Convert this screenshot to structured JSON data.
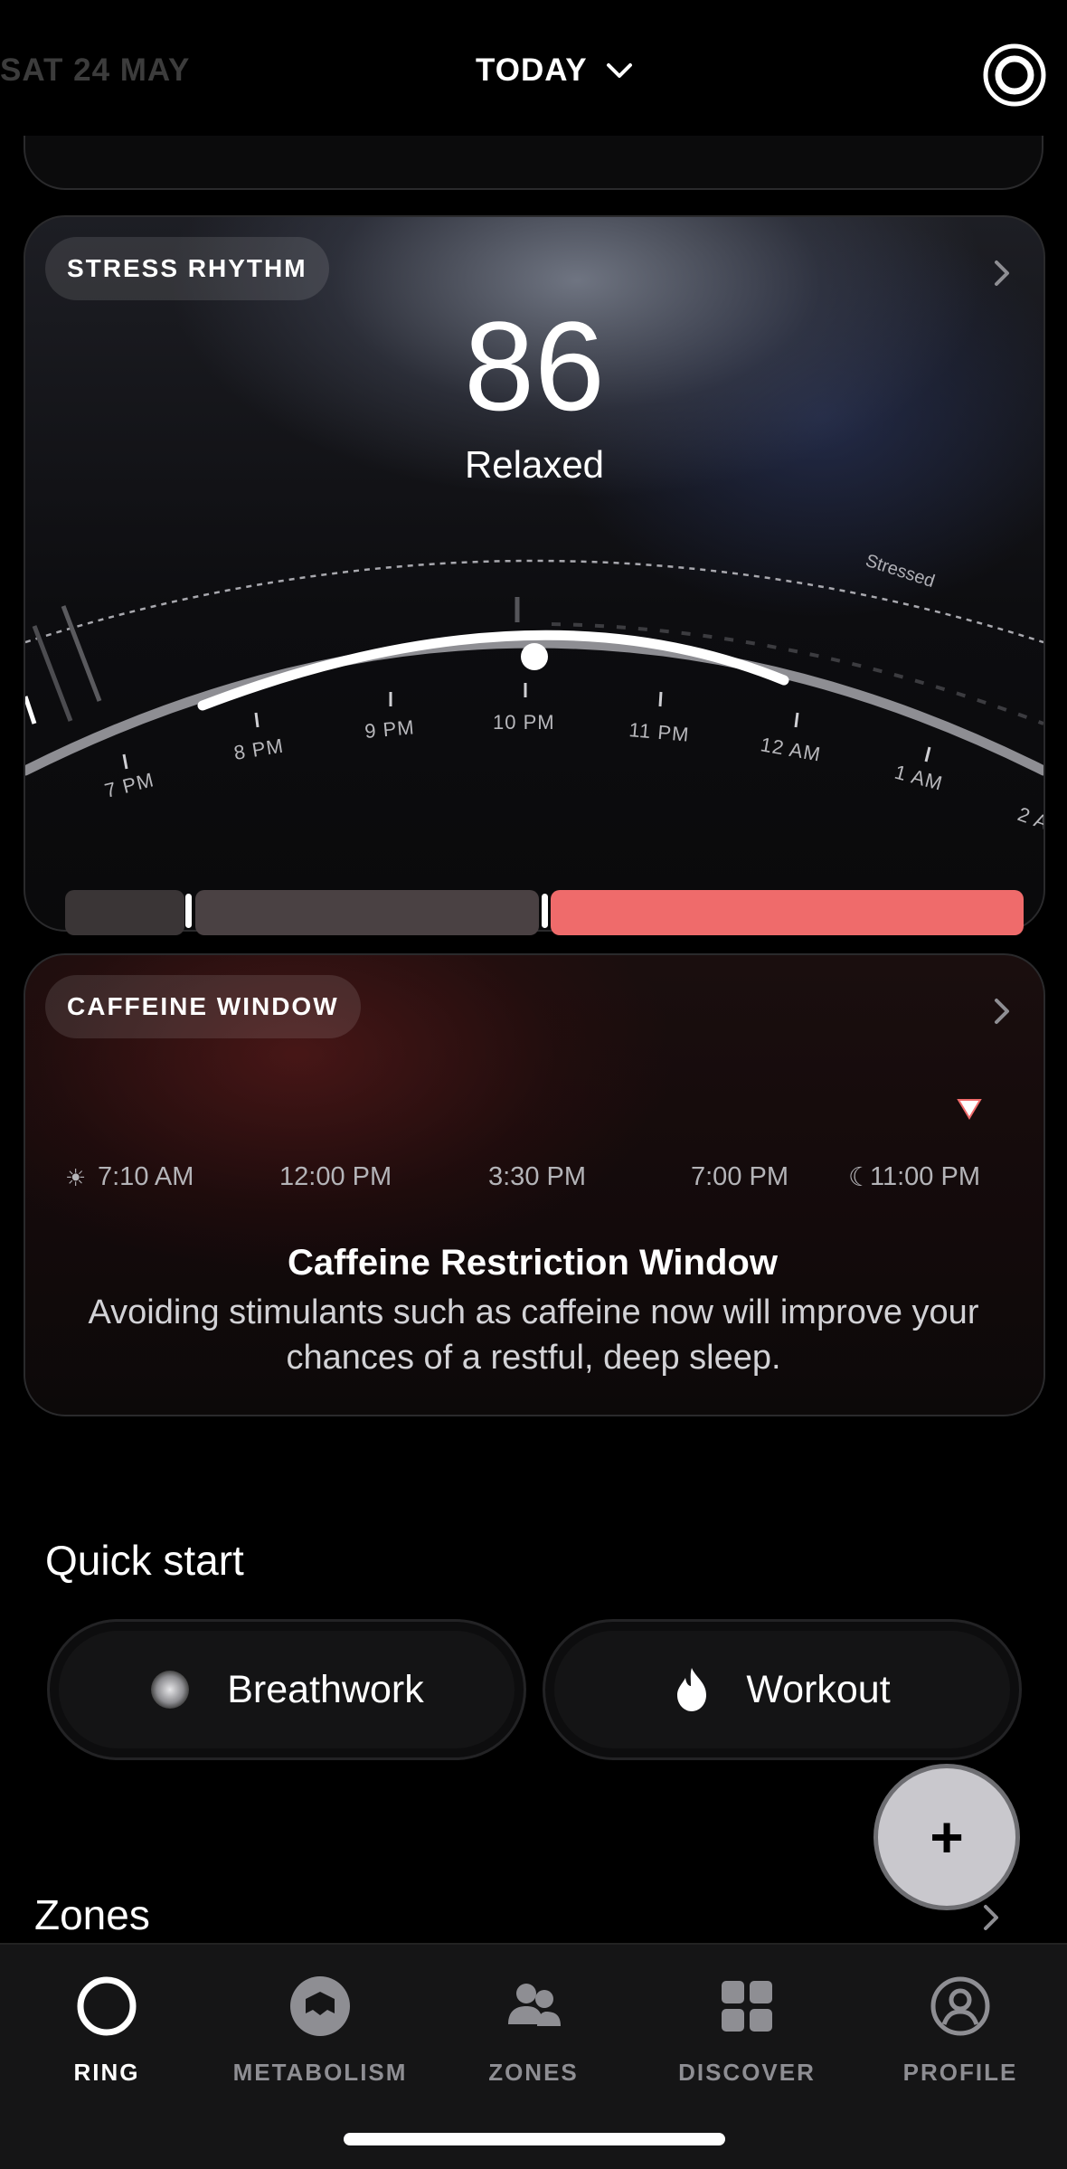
{
  "header": {
    "date": "SAT 24 MAY",
    "today_label": "TODAY"
  },
  "stress": {
    "title": "STRESS RHYTHM",
    "score": "86",
    "state": "Relaxed",
    "zone_label": "Stressed",
    "times": [
      "7 PM",
      "8 PM",
      "9 PM",
      "10 PM",
      "11 PM",
      "12 AM",
      "1 AM",
      "2 A"
    ]
  },
  "caffeine": {
    "title": "CAFFEINE WINDOW",
    "times": [
      "7:10 AM",
      "12:00 PM",
      "3:30 PM",
      "7:00 PM",
      "11:00 PM"
    ],
    "heading": "Caffeine Restriction Window",
    "body": "Avoiding stimulants such as caffeine now will improve your chances of a restful, deep sleep.",
    "restricted_color": "#ef6b6b"
  },
  "quick_start": {
    "title": "Quick start",
    "breathwork": "Breathwork",
    "workout": "Workout",
    "add": "+"
  },
  "zones_title": "Zones",
  "tabs": [
    {
      "label": "RING",
      "icon": "ring-icon",
      "active": true
    },
    {
      "label": "METABOLISM",
      "icon": "metabolism-icon",
      "active": false
    },
    {
      "label": "ZONES",
      "icon": "zones-icon",
      "active": false
    },
    {
      "label": "DISCOVER",
      "icon": "discover-icon",
      "active": false
    },
    {
      "label": "PROFILE",
      "icon": "profile-icon",
      "active": false
    }
  ]
}
